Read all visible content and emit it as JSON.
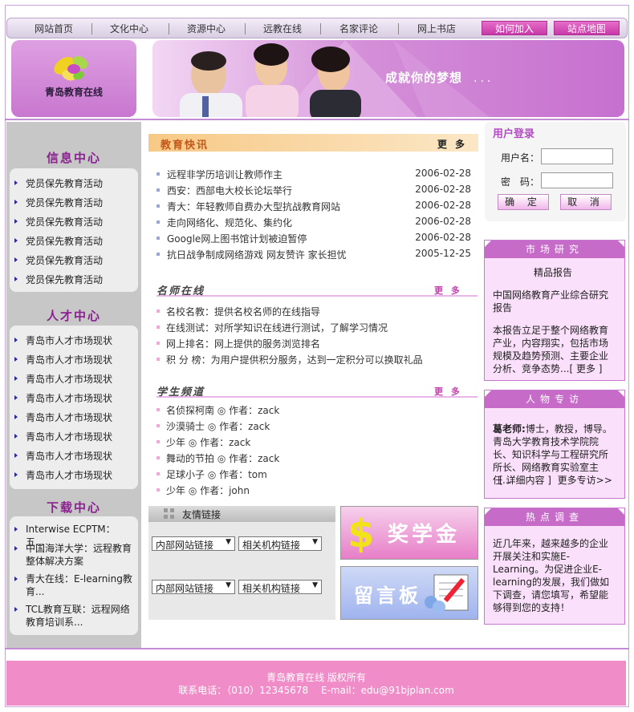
{
  "nav": {
    "items": [
      "网站首页",
      "文化中心",
      "资源中心",
      "远教在线",
      "名家评论",
      "网上书店"
    ],
    "join": "如何加入",
    "sitemap": "站点地图"
  },
  "brand": {
    "logo_text": "青岛教育在线",
    "slogan": "成就你的梦想",
    "slogan_dots": "..."
  },
  "left": {
    "info_title": "信息中心",
    "info_items": [
      "党员保先教育活动",
      "党员保先教育活动",
      "党员保先教育活动",
      "党员保先教育活动",
      "党员保先教育活动",
      "党员保先教育活动"
    ],
    "talent_title": "人才中心",
    "talent_items": [
      "青岛市人才市场现状",
      "青岛市人才市场现状",
      "青岛市人才市场现状",
      "青岛市人才市场现状",
      "青岛市人才市场现状",
      "青岛市人才市场现状",
      "青岛市人才市场现状",
      "青岛市人才市场现状"
    ],
    "download_title": "下载中心",
    "download_items": [
      "Interwise ECPTM：五...",
      "中国海洋大学：远程教育整体解决方案",
      "青大在线：E-learning教育...",
      "TCL教育互联：远程网络教育培训系..."
    ]
  },
  "news": {
    "title": "教育快讯",
    "more": "更 多",
    "items": [
      {
        "title": "远程非学历培训让教师作主",
        "date": "2006-02-28"
      },
      {
        "title": "西安：西部电大校长论坛举行",
        "date": "2006-02-28"
      },
      {
        "title": "青大：年轻教师自费办大型抗战教育网站",
        "date": "2006-02-28"
      },
      {
        "title": "走向网络化、规范化、集约化",
        "date": "2006-02-28"
      },
      {
        "title": "Google网上图书馆计划被迫暂停",
        "date": "2006-02-28"
      },
      {
        "title": "抗日战争制成网络游戏 网友赞许 家长担忧",
        "date": "2005-12-25"
      }
    ]
  },
  "teachers": {
    "title": "名师在线",
    "more": "更 多",
    "items": [
      "名校名教：提供名校名师的在线指导",
      "在线测试：对所学知识在线进行测试，了解学习情况",
      "网上排名：网上提供的服务浏览排名",
      "积 分 榜：为用户提供积分服务，达到一定积分可以换取礼品"
    ]
  },
  "students": {
    "title": "学生频道",
    "more": "更 多",
    "items": [
      "名侦探柯南 ◎ 作者：zack",
      "沙漠骑士 ◎ 作者：zack",
      "少年 ◎ 作者：zack",
      "舞动的节拍 ◎ 作者：zack",
      "足球小子 ◎ 作者：tom",
      "少年 ◎ 作者：john"
    ]
  },
  "links": {
    "title": "友情链接",
    "select_internal": "内部网站链接",
    "select_related": "相关机构链接"
  },
  "ads": {
    "scholarship": "奖学金",
    "guestbook": "留言板"
  },
  "login": {
    "title": "用户登录",
    "username_label": "用户名：",
    "password_label": "密　码：",
    "confirm": "确 定",
    "cancel": "取 消"
  },
  "market": {
    "title": "市场研究",
    "subtitle": "精品报告",
    "report": "中国网络教育产业综合研究报告",
    "body": "本报告立足于整个网络教育产业，内容翔实，包括市场规模及趋势预测、主要企业分析、竞争态势...",
    "more": "[ 更多 ]"
  },
  "people": {
    "title": "人物专访",
    "name": "葛老师:",
    "body": "博士，教授，博导。青岛大学教育技术学院院长、知识科学与工程研究所所长、网络教育实验室主任...",
    "detail": "[ 详细内容 ]",
    "more": "更多专访>>"
  },
  "survey": {
    "title": "热点调查",
    "body": "近几年来，越来越多的企业开展关注和实施E-Learning。为促进企业E-learning的发展，我们做如下调查，请您填写，希望能够得到您的支持！"
  },
  "footer": {
    "copyright": "青岛教育在线 版权所有",
    "contact": "联系电话：（010）12345678　 E-mail：edu@91bjplan.com"
  },
  "colors": {
    "accent": "#c66cc8",
    "footer": "#f08cc7",
    "news_orange": "#c4561a"
  }
}
